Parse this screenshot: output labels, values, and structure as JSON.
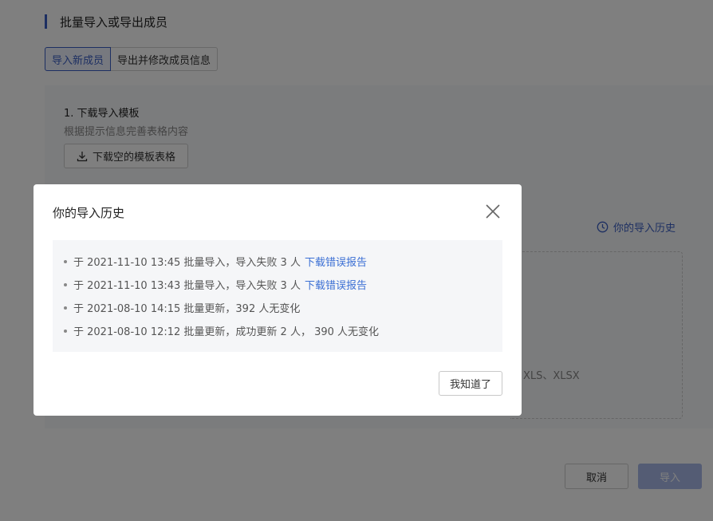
{
  "section": {
    "title": "批量导入或导出成员"
  },
  "tabs": [
    {
      "label": "导入新成员"
    },
    {
      "label": "导出并修改成员信息"
    }
  ],
  "step1": {
    "title": "1. 下载导入模板",
    "desc": "根据提示信息完善表格内容",
    "download_label": "下载空的模板表格"
  },
  "history_link": {
    "label": "你的导入历史"
  },
  "dropzone": {
    "formats": "XLS、XLSX"
  },
  "footer": {
    "cancel_label": "取消",
    "import_label": "导入"
  },
  "modal": {
    "title": "你的导入历史",
    "ok_label": "我知道了",
    "items": [
      {
        "text": "于 2021-11-10 13:45 批量导入，导入失败 3 人",
        "link": "下载错误报告"
      },
      {
        "text": "于 2021-11-10 13:43 批量导入，导入失败 3 人",
        "link": "下载错误报告"
      },
      {
        "text": "于 2021-08-10 14:15 批量更新，392 人无变化",
        "link": ""
      },
      {
        "text": "于 2021-08-10 12:12 批量更新，成功更新 2 人， 390 人无变化",
        "link": ""
      }
    ]
  },
  "colors": {
    "accent": "#3b5fc4",
    "link": "#3b6fd4",
    "import_disabled": "#a8b8e8"
  },
  "icons": {
    "download": "download-icon",
    "history": "clock-icon",
    "close": "close-icon"
  }
}
